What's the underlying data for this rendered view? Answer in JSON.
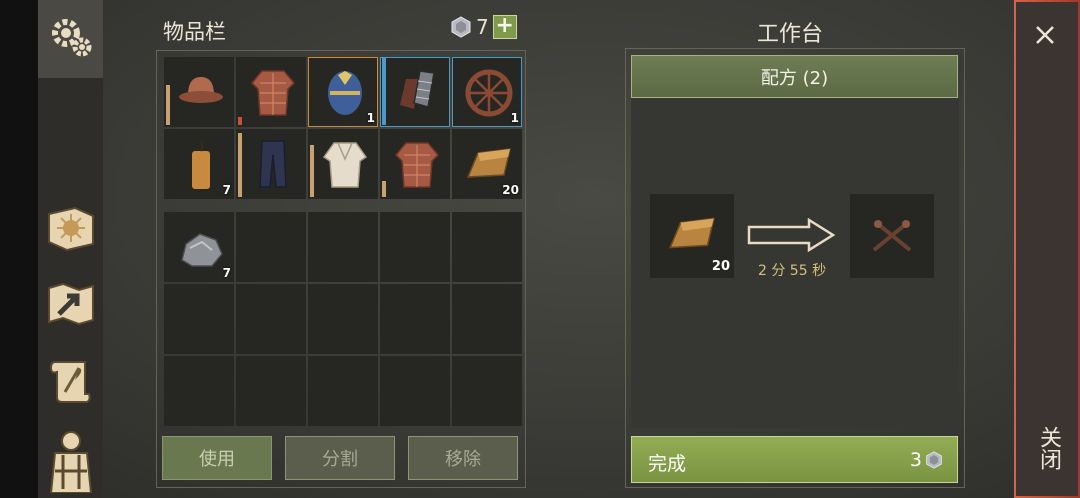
{
  "inventory": {
    "title": "物品栏",
    "gem_count": "7",
    "add_label": "+",
    "slots": [
      {
        "name": "helmet",
        "qty": ""
      },
      {
        "name": "padded-jacket",
        "qty": ""
      },
      {
        "name": "easter-egg",
        "qty": "1"
      },
      {
        "name": "armored-gloves",
        "qty": ""
      },
      {
        "name": "wooden-wheel",
        "qty": "1"
      },
      {
        "name": "candle",
        "qty": "7"
      },
      {
        "name": "pants",
        "qty": ""
      },
      {
        "name": "white-shirt",
        "qty": ""
      },
      {
        "name": "padded-jacket-2",
        "qty": ""
      },
      {
        "name": "copper-ingot",
        "qty": "20"
      },
      {
        "name": "stone",
        "qty": "7"
      }
    ],
    "buttons": {
      "use": "使用",
      "split": "分割",
      "remove": "移除"
    }
  },
  "workbench": {
    "title": "工作台",
    "recipe_label": "配方 (2)",
    "input_qty": "20",
    "timer": "2 分 55 秒",
    "complete_label": "完成",
    "complete_cost": "3"
  },
  "close": {
    "label": "关闭"
  },
  "colors": {
    "accent_green": "#7a9342",
    "close_red": "#d96248",
    "slot_orange": "#c98a3a",
    "slot_blue": "#4f98c6"
  }
}
